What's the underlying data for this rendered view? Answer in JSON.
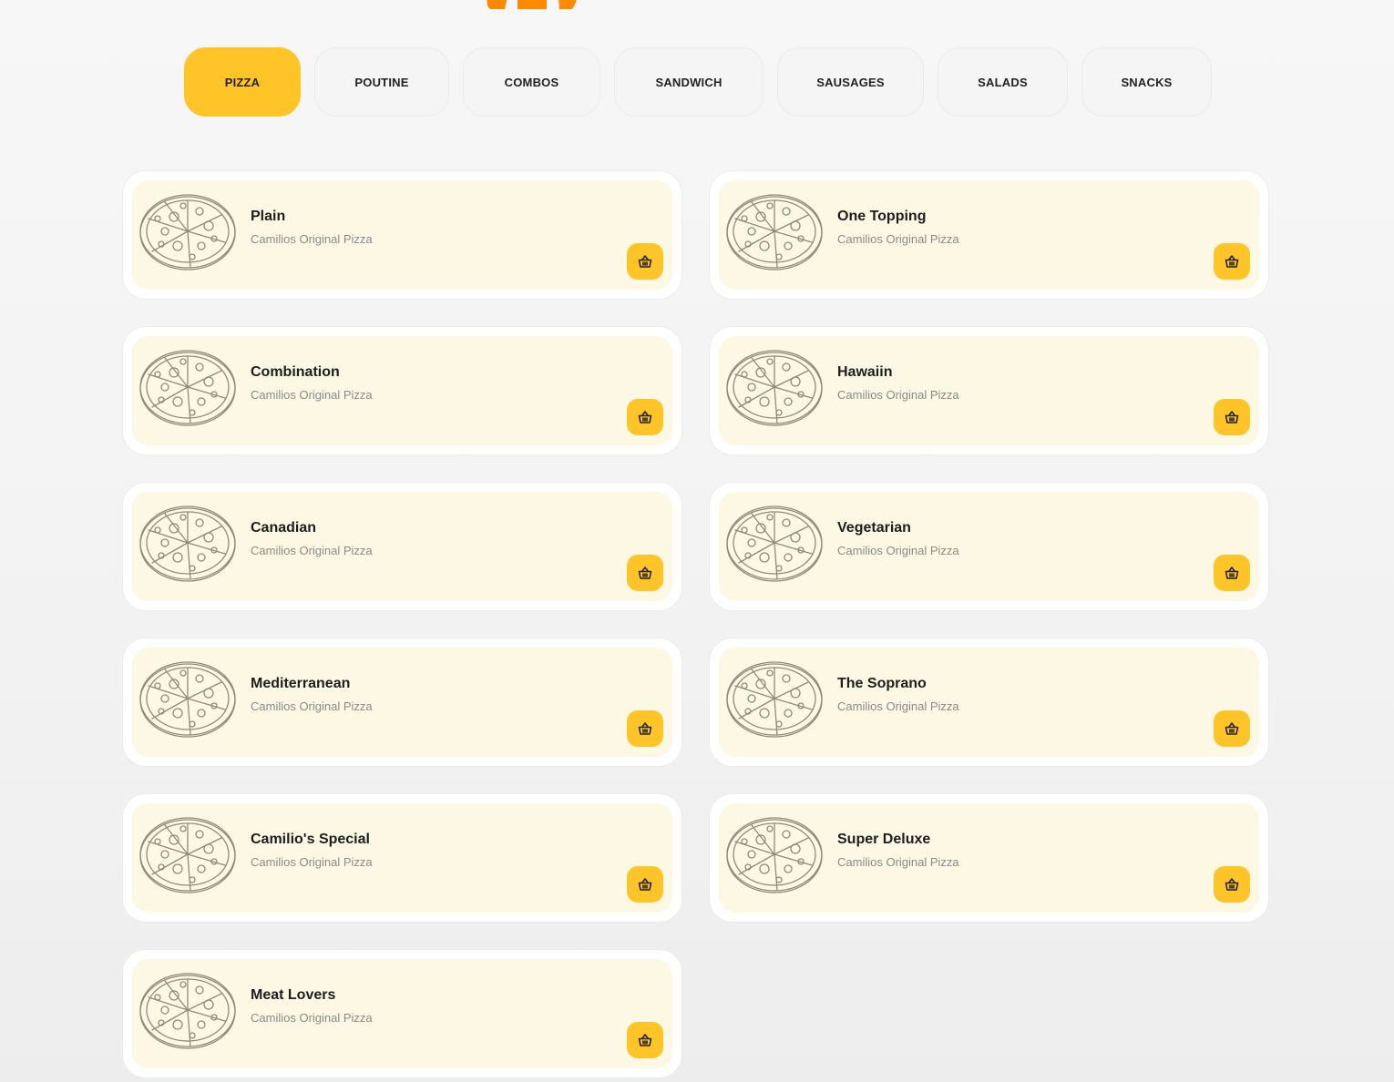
{
  "brand": {
    "accent": "#ffc427",
    "logo_color": "#ff8a00",
    "card_bg": "#fdf8e4"
  },
  "tabs": [
    {
      "label": "PIZZA",
      "active": true
    },
    {
      "label": "POUTINE"
    },
    {
      "label": "COMBOS"
    },
    {
      "label": "SANDWICH"
    },
    {
      "label": "SAUSAGES"
    },
    {
      "label": "SALADS"
    },
    {
      "label": "SNACKS"
    }
  ],
  "menu": {
    "items": [
      {
        "name": "Plain",
        "subtitle": "Camilios Original Pizza"
      },
      {
        "name": "One Topping",
        "subtitle": "Camilios Original Pizza"
      },
      {
        "name": "Combination",
        "subtitle": "Camilios Original Pizza"
      },
      {
        "name": "Hawaiin",
        "subtitle": "Camilios Original Pizza"
      },
      {
        "name": "Canadian",
        "subtitle": "Camilios Original Pizza"
      },
      {
        "name": "Vegetarian",
        "subtitle": "Camilios Original Pizza"
      },
      {
        "name": "Mediterranean",
        "subtitle": "Camilios Original Pizza"
      },
      {
        "name": "The Soprano",
        "subtitle": "Camilios Original Pizza"
      },
      {
        "name": "Camilio's Special",
        "subtitle": "Camilios Original Pizza"
      },
      {
        "name": "Super Deluxe",
        "subtitle": "Camilios Original Pizza"
      },
      {
        "name": "Meat Lovers",
        "subtitle": "Camilios Original Pizza"
      }
    ],
    "item_image_icon": "pizza-sketch-icon",
    "cart_icon": "basket-icon"
  }
}
